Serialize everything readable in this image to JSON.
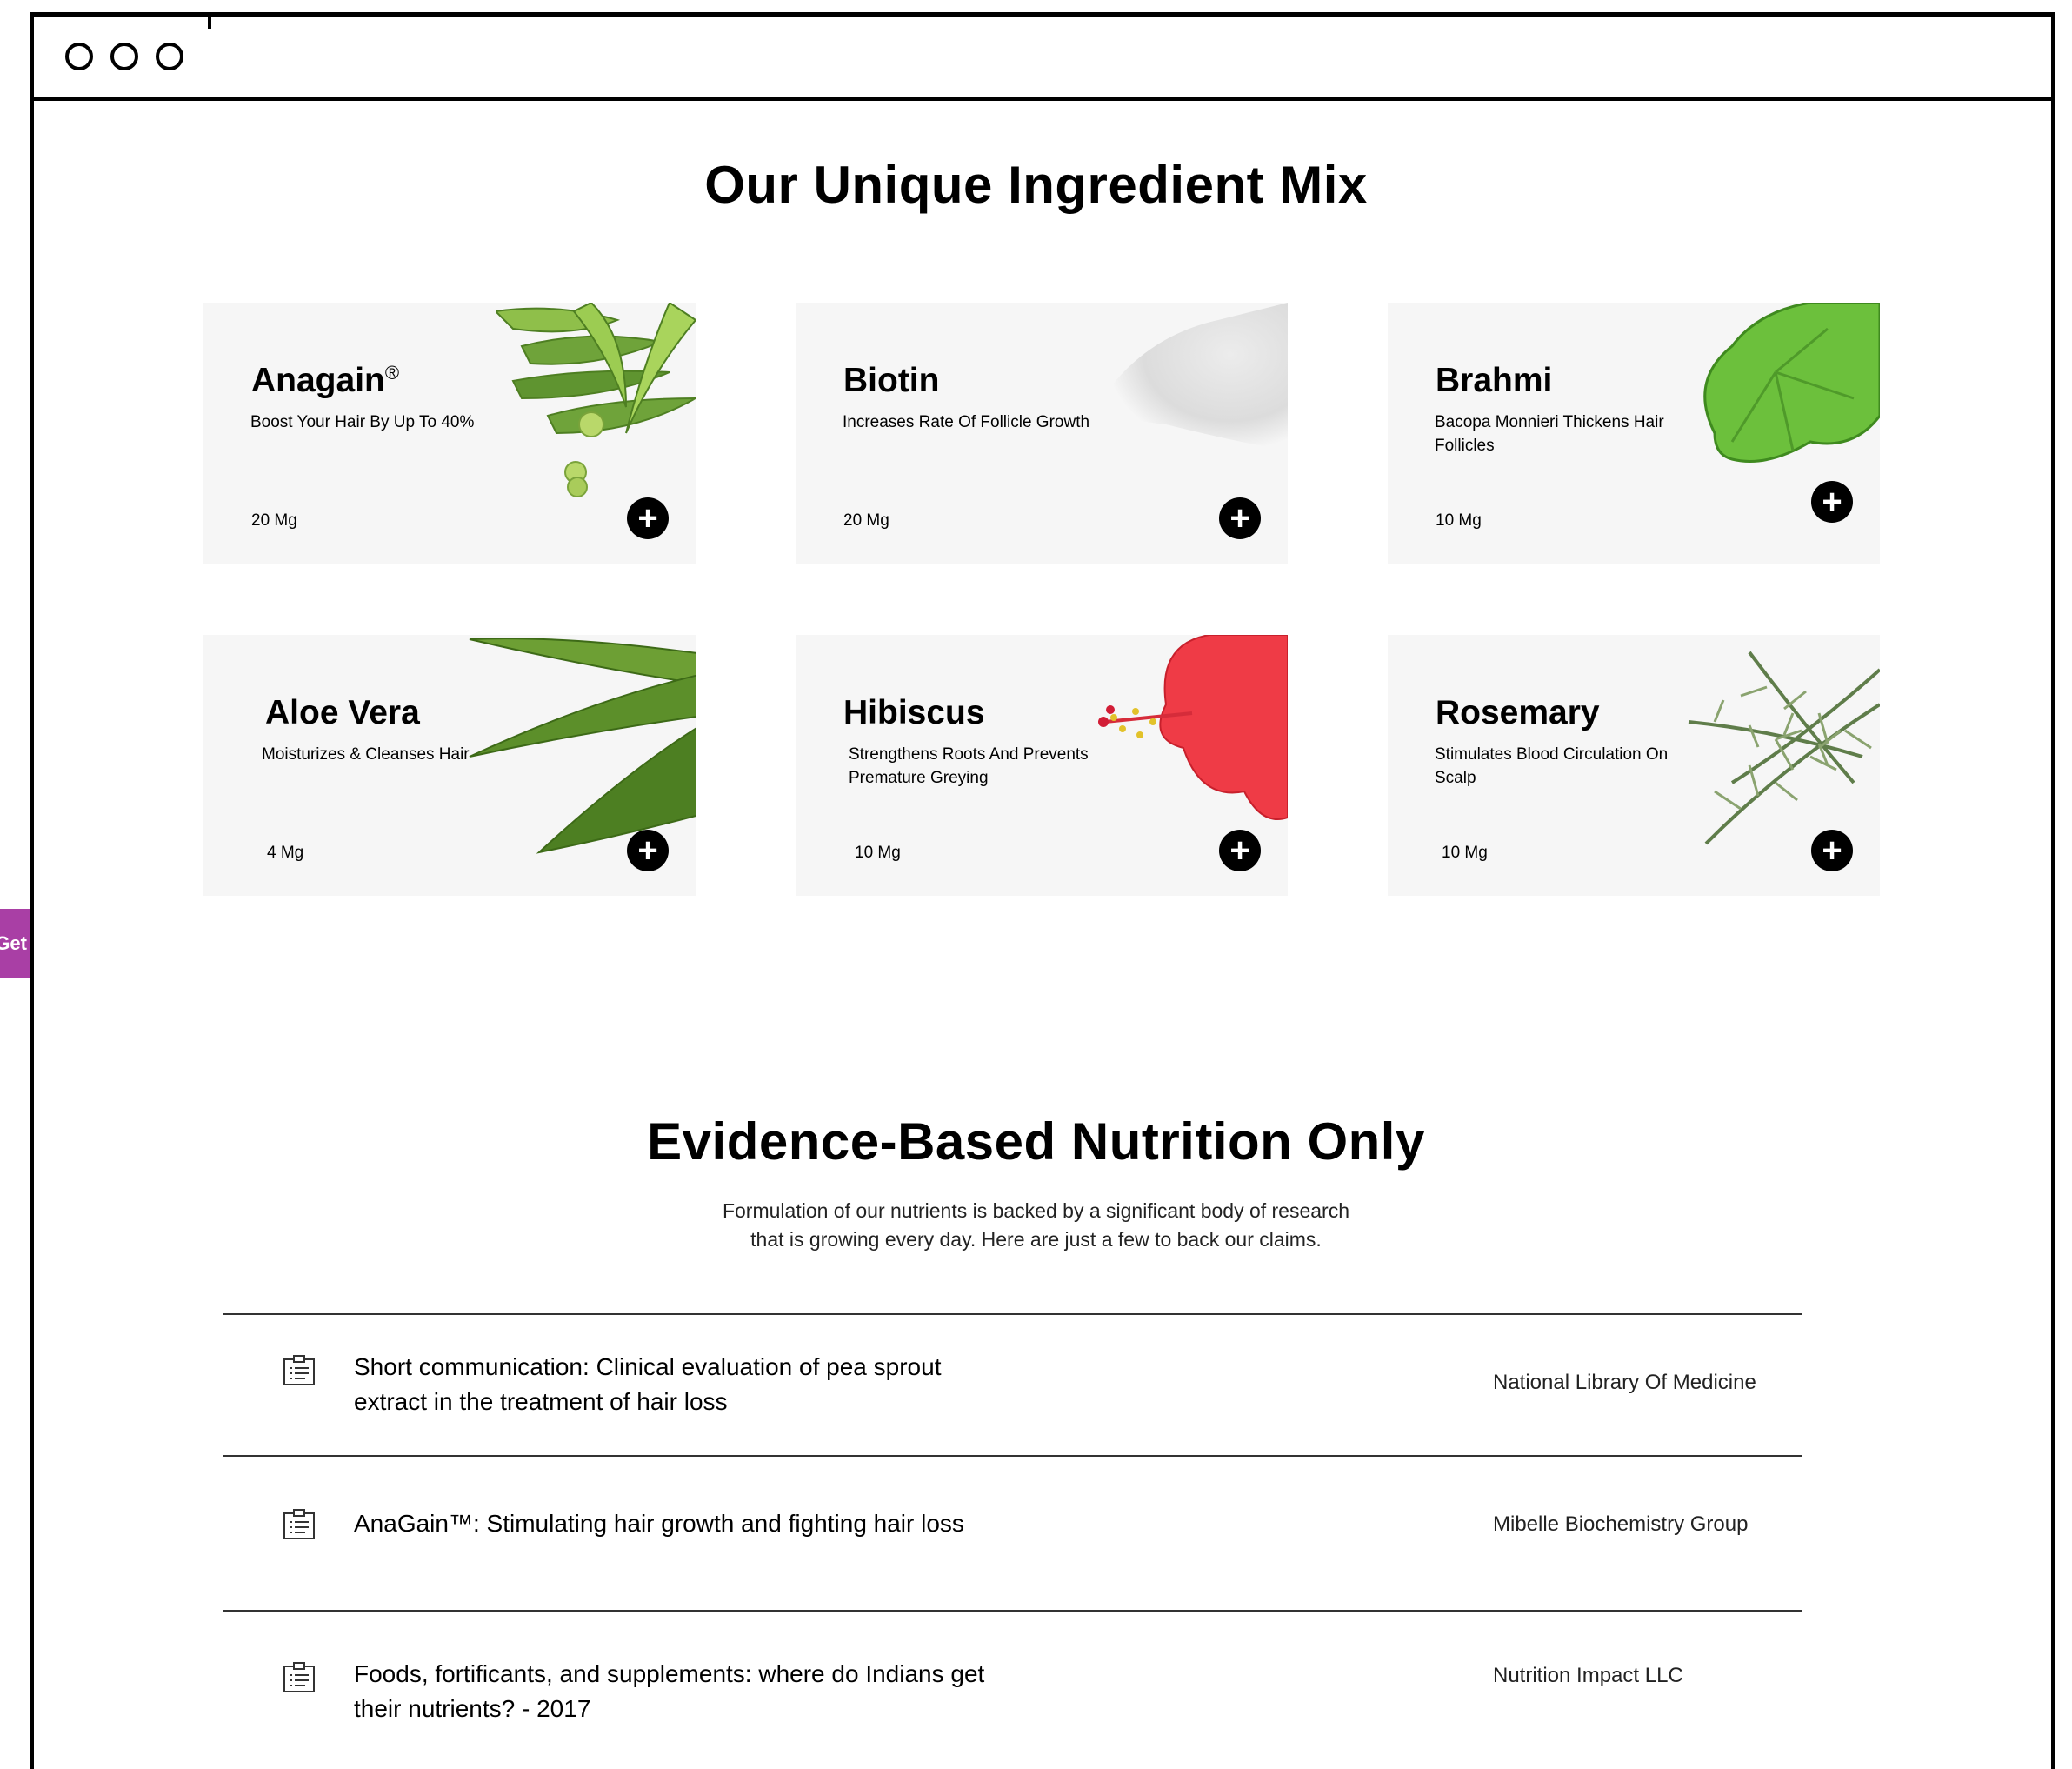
{
  "side_tab": {
    "label": "Get"
  },
  "section1": {
    "title": "Our Unique Ingredient Mix"
  },
  "ingredients": [
    {
      "name": "Anagain",
      "mark": "®",
      "description": "Boost Your Hair By Up To 40%",
      "dose": "20 Mg",
      "image": "pea-pods-image"
    },
    {
      "name": "Biotin",
      "mark": "",
      "description": "Increases Rate Of Follicle Growth",
      "dose": "20 Mg",
      "image": "white-powder-image"
    },
    {
      "name": "Brahmi",
      "mark": "",
      "description": "Bacopa Monnieri Thickens  Hair Follicles",
      "dose": "10 Mg",
      "image": "brahmi-leaf-image"
    },
    {
      "name": "Aloe Vera",
      "mark": "",
      "description": "Moisturizes & Cleanses Hair",
      "dose": "4 Mg",
      "image": "aloe-vera-image"
    },
    {
      "name": "Hibiscus",
      "mark": "",
      "description": "Strengthens Roots And Prevents Premature Greying",
      "dose": "10 Mg",
      "image": "hibiscus-flower-image"
    },
    {
      "name": "Rosemary",
      "mark": "",
      "description": "Stimulates Blood Circulation On Scalp",
      "dose": "10 Mg",
      "image": "rosemary-sprig-image"
    }
  ],
  "section2": {
    "title": "Evidence-Based Nutrition Only",
    "subtitle_line1": "Formulation of our nutrients is backed by a significant body of research",
    "subtitle_line2": "that is growing every day. Here are just a few to back our claims."
  },
  "studies": [
    {
      "title": "Short communication: Clinical evaluation of pea sprout extract in the treatment of hair loss",
      "source": "National Library Of Medicine"
    },
    {
      "title": "AnaGain™: Stimulating hair growth and fighting hair loss",
      "source": "Mibelle Biochemistry Group"
    },
    {
      "title": "Foods, fortificants, and supplements: where do Indians get their nutrients? - 2017",
      "source": "Nutrition Impact LLC"
    }
  ],
  "colors": {
    "card_bg": "#f6f6f6",
    "side_tab": "#a93fa5",
    "text": "#000000"
  }
}
